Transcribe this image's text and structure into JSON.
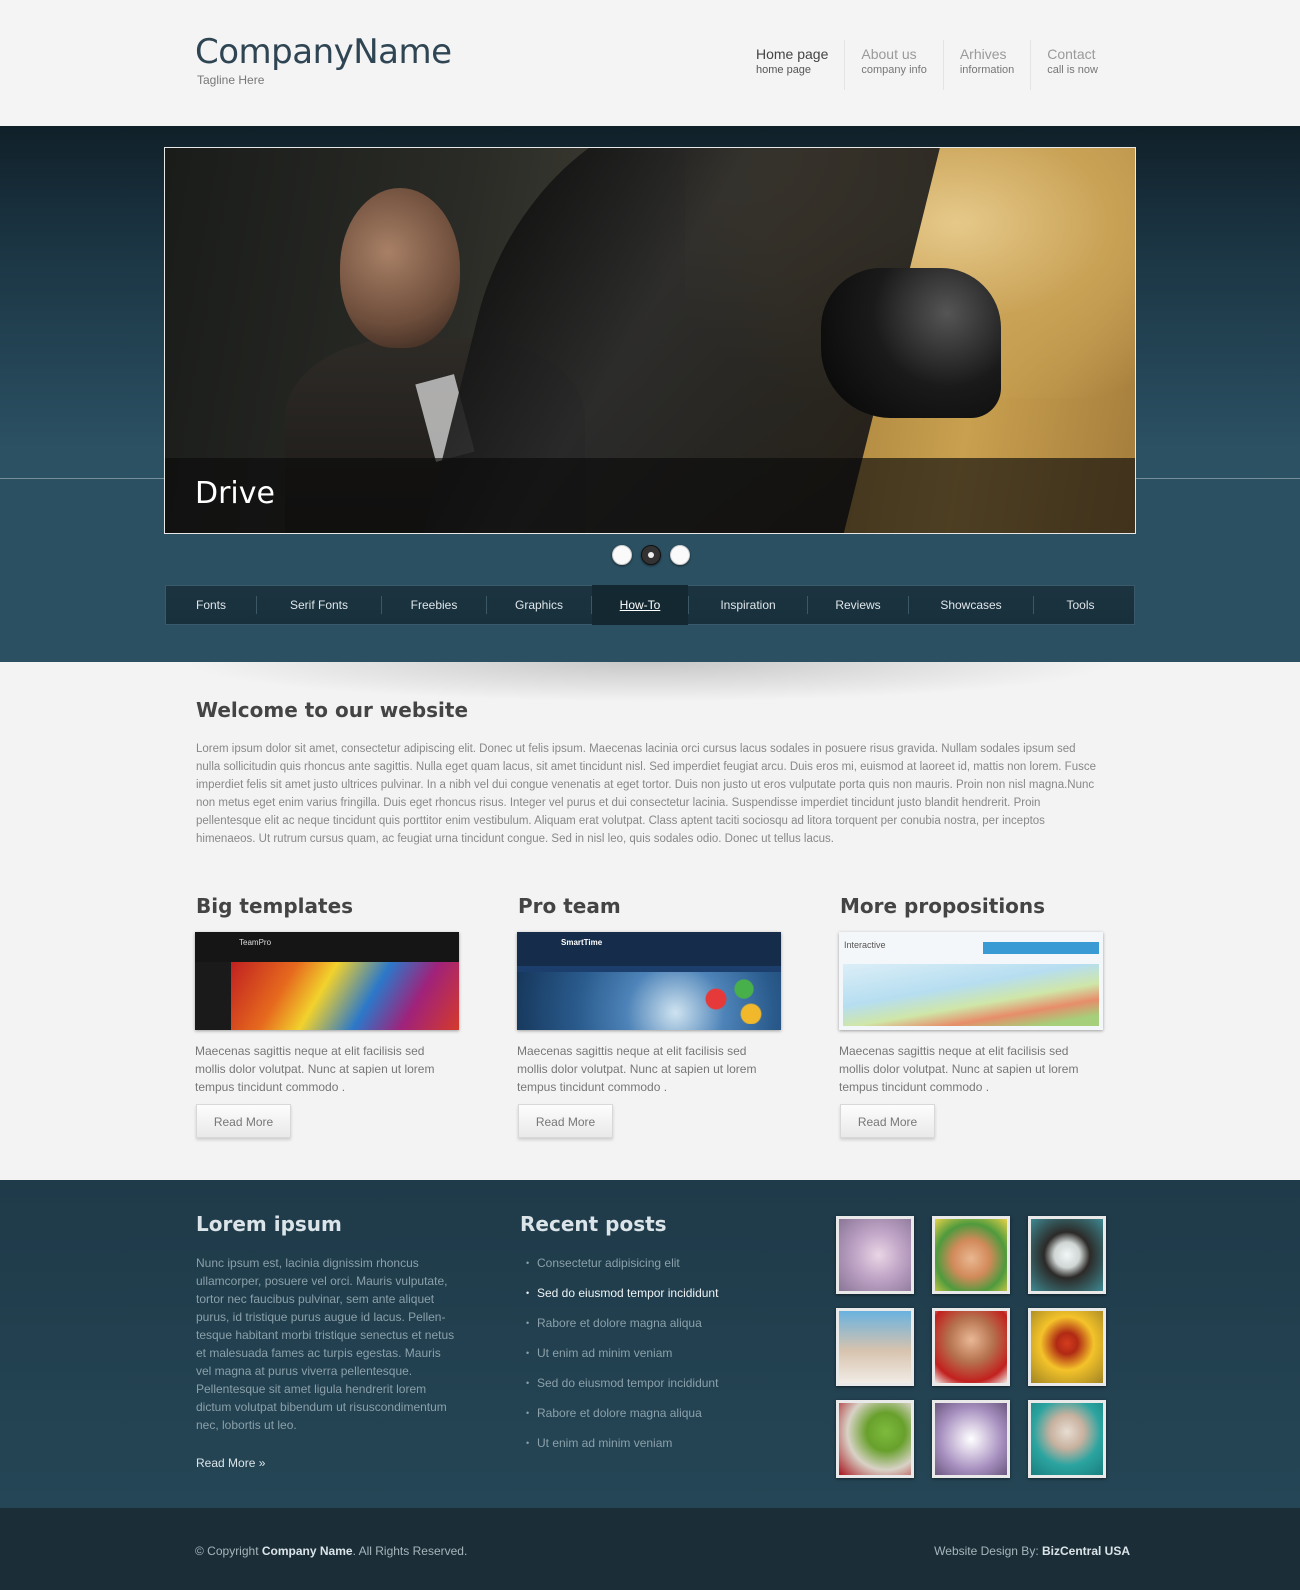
{
  "header": {
    "logo": "CompanyName",
    "tagline": "Tagline Here",
    "nav": [
      {
        "label": "Home page",
        "sub": "home page",
        "active": true
      },
      {
        "label": "About us",
        "sub": "company info"
      },
      {
        "label": "Arhives",
        "sub": "information"
      },
      {
        "label": "Contact",
        "sub": "call is now"
      }
    ]
  },
  "slider": {
    "caption": "Drive",
    "active_dot": 2
  },
  "main_nav": [
    "Fonts",
    "Serif Fonts",
    "Freebies",
    "Graphics",
    "How-To",
    "Inspiration",
    "Reviews",
    "Showcases",
    "Tools"
  ],
  "main_nav_active": "How-To",
  "welcome": {
    "title": "Welcome to our website",
    "text": "Lorem ipsum dolor sit amet, consectetur adipiscing elit. Donec ut felis ipsum. Maecenas lacinia orci cursus lacus sodales in posuere risus gravida. Nullam sodales ipsum sed nulla sollicitudin quis rhoncus ante sagittis. Nulla eget quam lacus, sit amet tincidunt nisl. Sed imperdiet feugiat arcu. Duis eros mi, euismod at laoreet id, mattis non lorem. Fusce imperdiet felis sit amet justo ultrices pulvinar. In a nibh vel dui congue venenatis at eget tortor. Duis non justo ut eros vulputate porta quis non mauris. Proin non nisl magna.Nunc non metus eget enim varius fringilla. Duis eget rhoncus risus. Integer vel purus et dui consectetur lacinia. Suspendisse imperdiet tincidunt justo blandit hendrerit. Proin pellentesque elit ac neque tincidunt quis porttitor enim vestibulum. Aliquam erat volutpat. Class aptent taciti sociosqu ad litora torquent per conubia nostra, per inceptos himenaeos. Ut rutrum cursus quam, ac feugiat urna tincidunt congue. Sed in nisl leo, quis sodales odio. Donec ut tellus lacus."
  },
  "columns": [
    {
      "title": "Big templates",
      "thumb_label": "TeamPro",
      "text": "Maecenas sagittis neque at elit facilisis sed mollis dolor volutpat. Nunc at sapien ut lorem tempus tincidunt commodo .",
      "button": "Read More"
    },
    {
      "title": "Pro team",
      "thumb_label": "SmartTime",
      "text": "Maecenas sagittis neque at elit facilisis sed mollis dolor volutpat. Nunc at sapien ut lorem tempus tincidunt commodo .",
      "button": "Read More"
    },
    {
      "title": "More propositions",
      "thumb_label": "Interactive",
      "text": "Maecenas sagittis neque at elit facilisis sed mollis dolor volutpat. Nunc at sapien ut lorem tempus tincidunt commodo .",
      "button": "Read More"
    }
  ],
  "footer": {
    "about_title": "Lorem ipsum",
    "about_text": "Nunc ipsum est, lacinia dignissim rhoncus ullamcorper, posuere vel orci. Mauris vulputate, tortor nec faucibus pulvinar, sem ante aliquet purus, id tristique purus augue id lacus. Pellen-tesque habitant morbi tristique senectus et netus et malesuada fames ac turpis egestas. Mauris vel magna at purus viverra pellentesque. Pellentesque sit amet ligula hendrerit lorem dictum volutpat bibendum ut risuscondimentum nec, lobortis ut leo.",
    "about_link": "Read More »",
    "posts_title": "Recent posts",
    "posts": [
      "Consectetur adipisicing elit",
      "Sed do eiusmod tempor incididunt",
      "Rabore et dolore magna aliqua",
      "Ut enim ad minim veniam",
      "Sed do eiusmod tempor incididunt",
      "Rabore et dolore magna aliqua",
      "Ut enim ad minim veniam"
    ],
    "posts_highlight": 1,
    "gallery": [
      "flower-photo",
      "child-photo",
      "friends-photo",
      "couple-photo",
      "woman-flower-photo",
      "ladybug-photo",
      "cup-rose-photo",
      "purple-flower-photo",
      "scarf-eyes-photo"
    ]
  },
  "bottom": {
    "copyright_prefix": "© Copyright ",
    "copyright_name": "Company Name",
    "copyright_suffix": ". All Rights Reserved.",
    "credit_prefix": "Website Design By: ",
    "credit_name": "BizCentral USA"
  },
  "colors": {
    "band": "#2b5062",
    "nav_bg": "#1c3340",
    "footer_bg": "#254656",
    "bottom_bg": "#1b2e38",
    "logo": "#2f4553"
  }
}
